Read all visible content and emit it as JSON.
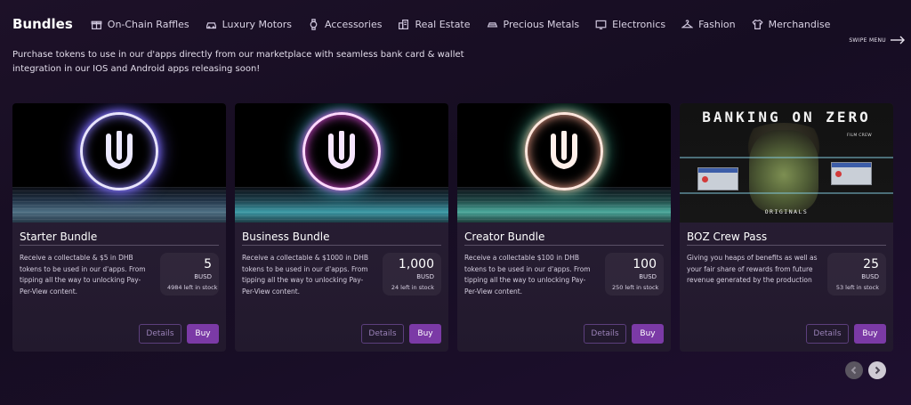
{
  "nav": {
    "title": "Bundles",
    "items": [
      {
        "label": "On-Chain Raffles",
        "icon": "gift-icon"
      },
      {
        "label": "Luxury Motors",
        "icon": "car-icon"
      },
      {
        "label": "Accessories",
        "icon": "watch-icon"
      },
      {
        "label": "Real Estate",
        "icon": "building-icon"
      },
      {
        "label": "Precious Metals",
        "icon": "gold-bar-icon"
      },
      {
        "label": "Electronics",
        "icon": "monitor-icon"
      },
      {
        "label": "Fashion",
        "icon": "hanger-icon"
      },
      {
        "label": "Merchandise",
        "icon": "tshirt-icon"
      }
    ]
  },
  "swipe_label": "SWIPE MENU",
  "description": "Purchase tokens to use in our d'apps directly from our marketplace with seamless bank card & wallet integration in our IOS and Android apps releasing soon!",
  "cards": [
    {
      "title": "Starter Bundle",
      "text": "Receive a collectable & $5 in DHB tokens to be used in our d'apps. From tipping all the way to unlocking Pay-Per-View content.",
      "price": "5",
      "currency": "BUSD",
      "stock": "4984 left in stock",
      "details_label": "Details",
      "buy_label": "Buy",
      "glow_color": "#8a7bff"
    },
    {
      "title": "Business Bundle",
      "text": "Receive a collectable & $1000 in DHB tokens to be used in our d'apps. From tipping all the way to unlocking Pay-Per-View content.",
      "price": "1,000",
      "currency": "BUSD",
      "stock": "24 left in stock",
      "details_label": "Details",
      "buy_label": "Buy",
      "glow_color": "#e14fe0"
    },
    {
      "title": "Creator Bundle",
      "text": "Receive a collectable $100 in DHB tokens to be used in our d'apps. From tipping all the way to unlocking Pay-Per-View content.",
      "price": "100",
      "currency": "BUSD",
      "stock": "250 left in stock",
      "details_label": "Details",
      "buy_label": "Buy",
      "glow_color": "#f0a08a"
    },
    {
      "title": "BOZ Crew Pass",
      "text": "Giving you heaps of benefits as well as your fair share of rewards from future revenue generated by the production",
      "price": "25",
      "currency": "BUSD",
      "stock": "53 left in stock",
      "details_label": "Details",
      "buy_label": "Buy",
      "image_title": "BANKING ON ZERO",
      "image_subtitle": "FILM CREW",
      "image_footer": "ORIGINALS"
    }
  ],
  "colors": {
    "accent": "#7b3aa6",
    "background": "#1d1128",
    "card": "#2a2036"
  }
}
